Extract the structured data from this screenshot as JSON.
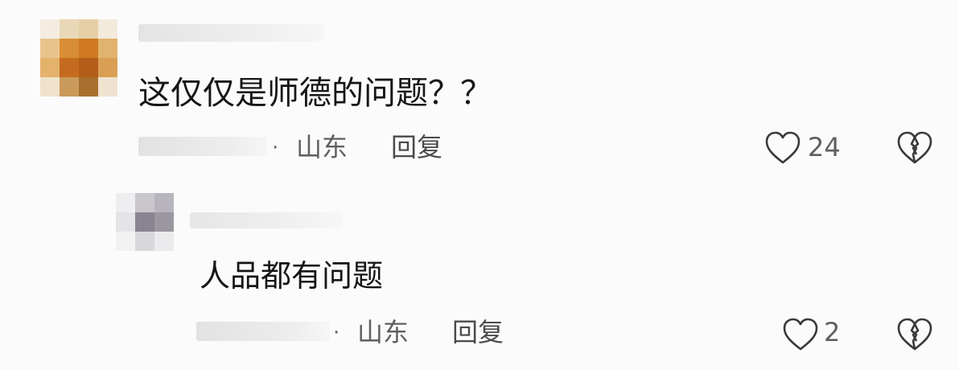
{
  "comments": [
    {
      "text": "这仅仅是师德的问题？？",
      "location": "山东",
      "separator": "·",
      "reply_label": "回复",
      "like_count": "24",
      "icons": [
        "heart-icon",
        "broken-heart-icon"
      ]
    }
  ],
  "replies": [
    {
      "text": "人品都有问题",
      "location": "山东",
      "separator": "·",
      "reply_label": "回复",
      "like_count": "2",
      "icons": [
        "heart-icon",
        "broken-heart-icon"
      ]
    }
  ],
  "colors": {
    "text": "#161616",
    "meta": "#5f5f5f",
    "avatar_main": [
      "#e3cfa8",
      "#d9a55c",
      "#c8752a",
      "#b5651d",
      "#a4621f"
    ],
    "avatar_reply": [
      "#d6d6dc",
      "#8a8590",
      "#6f6a78",
      "#c9c9cf"
    ]
  }
}
